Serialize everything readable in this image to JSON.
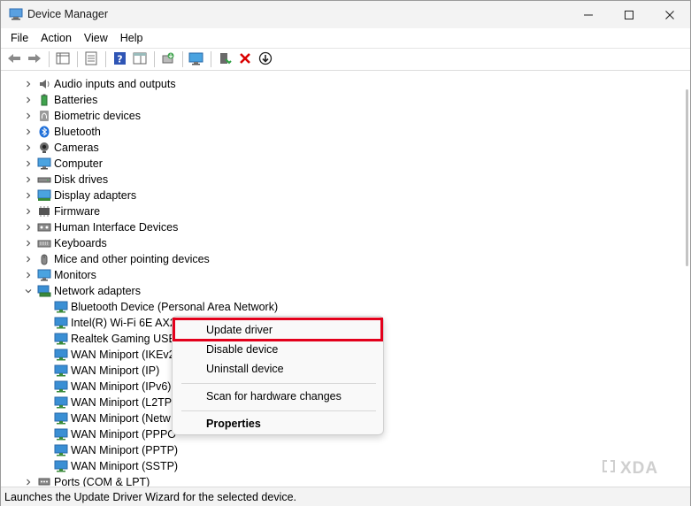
{
  "window": {
    "title": "Device Manager",
    "minimize_glyph": "—",
    "maximize_glyph": "☐",
    "close_glyph": "✕"
  },
  "menubar": {
    "items": [
      "File",
      "Action",
      "View",
      "Help"
    ]
  },
  "toolbar": {
    "icons": [
      "back-arrow-icon",
      "forward-arrow-icon",
      "show-hide-tree-icon",
      "properties-icon",
      "help-icon",
      "action-pane-icon",
      "update-driver-icon",
      "scan-hardware-icon",
      "enable-device-icon",
      "uninstall-icon",
      "disable-device-icon"
    ]
  },
  "tree": {
    "categories": [
      {
        "label": "Audio inputs and outputs",
        "icon": "speaker-icon",
        "expanded": false
      },
      {
        "label": "Batteries",
        "icon": "battery-icon",
        "expanded": false
      },
      {
        "label": "Biometric devices",
        "icon": "fingerprint-icon",
        "expanded": false
      },
      {
        "label": "Bluetooth",
        "icon": "bluetooth-icon",
        "expanded": false
      },
      {
        "label": "Cameras",
        "icon": "camera-icon",
        "expanded": false
      },
      {
        "label": "Computer",
        "icon": "monitor-icon",
        "expanded": false
      },
      {
        "label": "Disk drives",
        "icon": "disk-icon",
        "expanded": false
      },
      {
        "label": "Display adapters",
        "icon": "display-adapter-icon",
        "expanded": false
      },
      {
        "label": "Firmware",
        "icon": "chip-icon",
        "expanded": false
      },
      {
        "label": "Human Interface Devices",
        "icon": "hid-icon",
        "expanded": false
      },
      {
        "label": "Keyboards",
        "icon": "keyboard-icon",
        "expanded": false
      },
      {
        "label": "Mice and other pointing devices",
        "icon": "mouse-icon",
        "expanded": false
      },
      {
        "label": "Monitors",
        "icon": "monitor-icon",
        "expanded": false
      },
      {
        "label": "Network adapters",
        "icon": "network-adapter-icon",
        "expanded": true
      }
    ],
    "network_children": [
      "Bluetooth Device (Personal Area Network)",
      "Intel(R) Wi-Fi 6E AX2",
      "Realtek Gaming USB",
      "WAN Miniport (IKEv2",
      "WAN Miniport (IP)",
      "WAN Miniport (IPv6)",
      "WAN Miniport (L2TP",
      "WAN Miniport (Netw",
      "WAN Miniport (PPPO",
      "WAN Miniport (PPTP)",
      "WAN Miniport (SSTP)"
    ],
    "after": [
      {
        "label": "Ports (COM & LPT)",
        "icon": "port-icon",
        "expanded": false
      }
    ]
  },
  "context_menu": {
    "update_driver": "Update driver",
    "disable_device": "Disable device",
    "uninstall_device": "Uninstall device",
    "scan_hardware": "Scan for hardware changes",
    "properties": "Properties"
  },
  "status": {
    "text": "Launches the Update Driver Wizard for the selected device."
  },
  "watermark": {
    "text": "XDA"
  },
  "colors": {
    "highlight_border": "#e3001b",
    "bluetooth_blue": "#1e6fd9",
    "uninstall_red": "#d90000",
    "net_icon_blue": "#3a8fd4"
  }
}
